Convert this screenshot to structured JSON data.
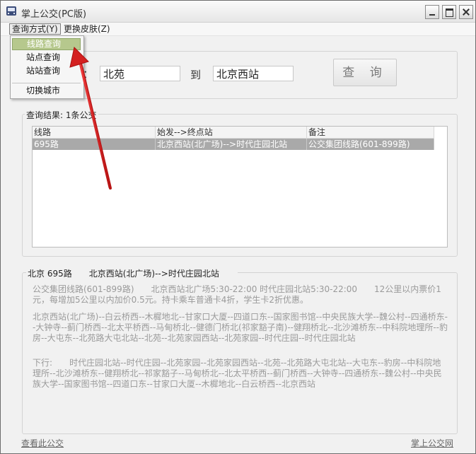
{
  "window": {
    "title": "掌上公交(PC版)"
  },
  "menubar": {
    "items": [
      "查询方式(Y)",
      "更换皮肤(Z)"
    ]
  },
  "dropdown": {
    "items": [
      "线路查询",
      "站点查询",
      "站站查询"
    ],
    "after_separator": "切换城市"
  },
  "search": {
    "colon": "：",
    "from_value": "北苑",
    "to_label": "到",
    "to_value": "北京西站",
    "query_button": "查 询"
  },
  "results": {
    "label": "查询结果: 1条公交",
    "columns": [
      "线路",
      "始发-->终点站",
      "备注"
    ],
    "rows": [
      [
        "695路",
        "北京西站(北广场)-->时代庄园北站",
        "公交集团线路(601-899路)"
      ]
    ]
  },
  "details": {
    "line_name": "北京 695路",
    "route": "北京西站(北广场)-->时代庄园北站",
    "info": "公交集团线路(601-899路)　　北京西站北广场5:30-22:00 时代庄园北站5:30-22:00　　12公里以内票价1元，每增加5公里以内加价0.5元。持卡乘车普通卡4折，学生卡2折优惠。",
    "up_stops": "北京西站(北广场)--白云桥西--木樨地北--甘家口大厦--四道口东--国家图书馆--中央民族大学--魏公村--四通桥东--大钟寺--蓟门桥西--北太平桥西--马甸桥北--健德门桥北(祁家豁子南)--健翔桥北--北沙滩桥东--中科院地理所--豹房--大屯东--北苑路大屯北站--北苑--北苑家园西站--北苑家园--时代庄园--时代庄园北站",
    "down_label": "下行:",
    "down_stops": "时代庄园北站--时代庄园--北苑家园--北苑家园西站--北苑--北苑路大屯北站--大屯东--豹房--中科院地理所--北沙滩桥东--健翔桥北--祁家豁子--马甸桥北--北太平桥西--蓟门桥西--大钟寺--四通桥东--魏公村--中央民族大学--国家图书馆--四道口东--甘家口大厦--木樨地北--白云桥西--北京西站"
  },
  "footer": {
    "left_link": "查看此公交",
    "right_link": "掌上公交网"
  },
  "colors": {
    "highlight": "#b6c88d",
    "selected_row": "#a9a9a9",
    "arrow": "#d42020"
  }
}
